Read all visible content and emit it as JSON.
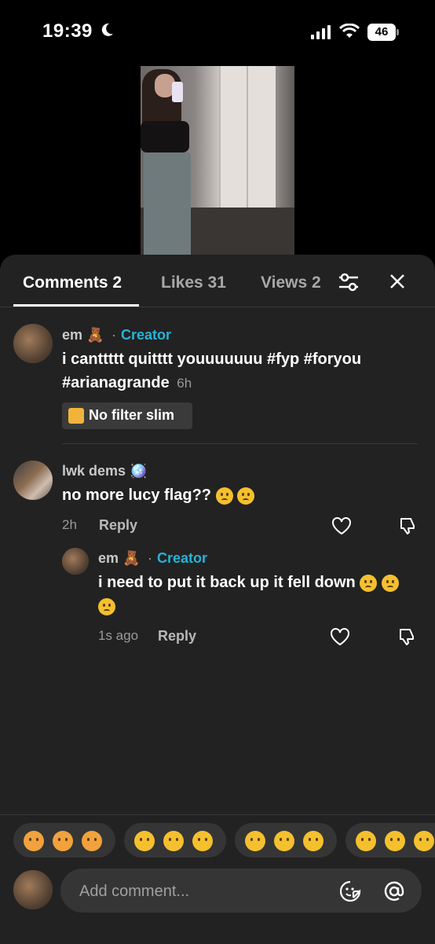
{
  "status_bar": {
    "time": "19:39",
    "battery": "46"
  },
  "tabs": [
    {
      "label": "Comments 2",
      "active": true
    },
    {
      "label": "Likes 31",
      "active": false
    },
    {
      "label": "Views 2",
      "active": false
    }
  ],
  "comments": [
    {
      "username": "em 🧸",
      "separator": "·",
      "badge": "Creator",
      "text": "i canttttt quitttt youuuuuuu #fyp #foryou #arianagrande",
      "time": "6h",
      "filter_chip": "No filter slim"
    },
    {
      "username": "lwk dems 🪩",
      "text": "no more lucy flag??",
      "time": "2h",
      "reply_label": "Reply",
      "replies": [
        {
          "username": "em 🧸",
          "separator": "·",
          "badge": "Creator",
          "text": "i need to put it back up it fell down",
          "time": "1s ago",
          "reply_label": "Reply"
        }
      ]
    }
  ],
  "composer": {
    "placeholder": "Add comment..."
  },
  "colors": {
    "background": "#222222",
    "accent": "#27b3d8"
  },
  "icons": [
    "moon-icon",
    "signal-icon",
    "wifi-icon",
    "battery-icon",
    "filter-icon",
    "close-icon",
    "heart-icon",
    "dislike-icon",
    "sticker-icon",
    "at-icon"
  ]
}
